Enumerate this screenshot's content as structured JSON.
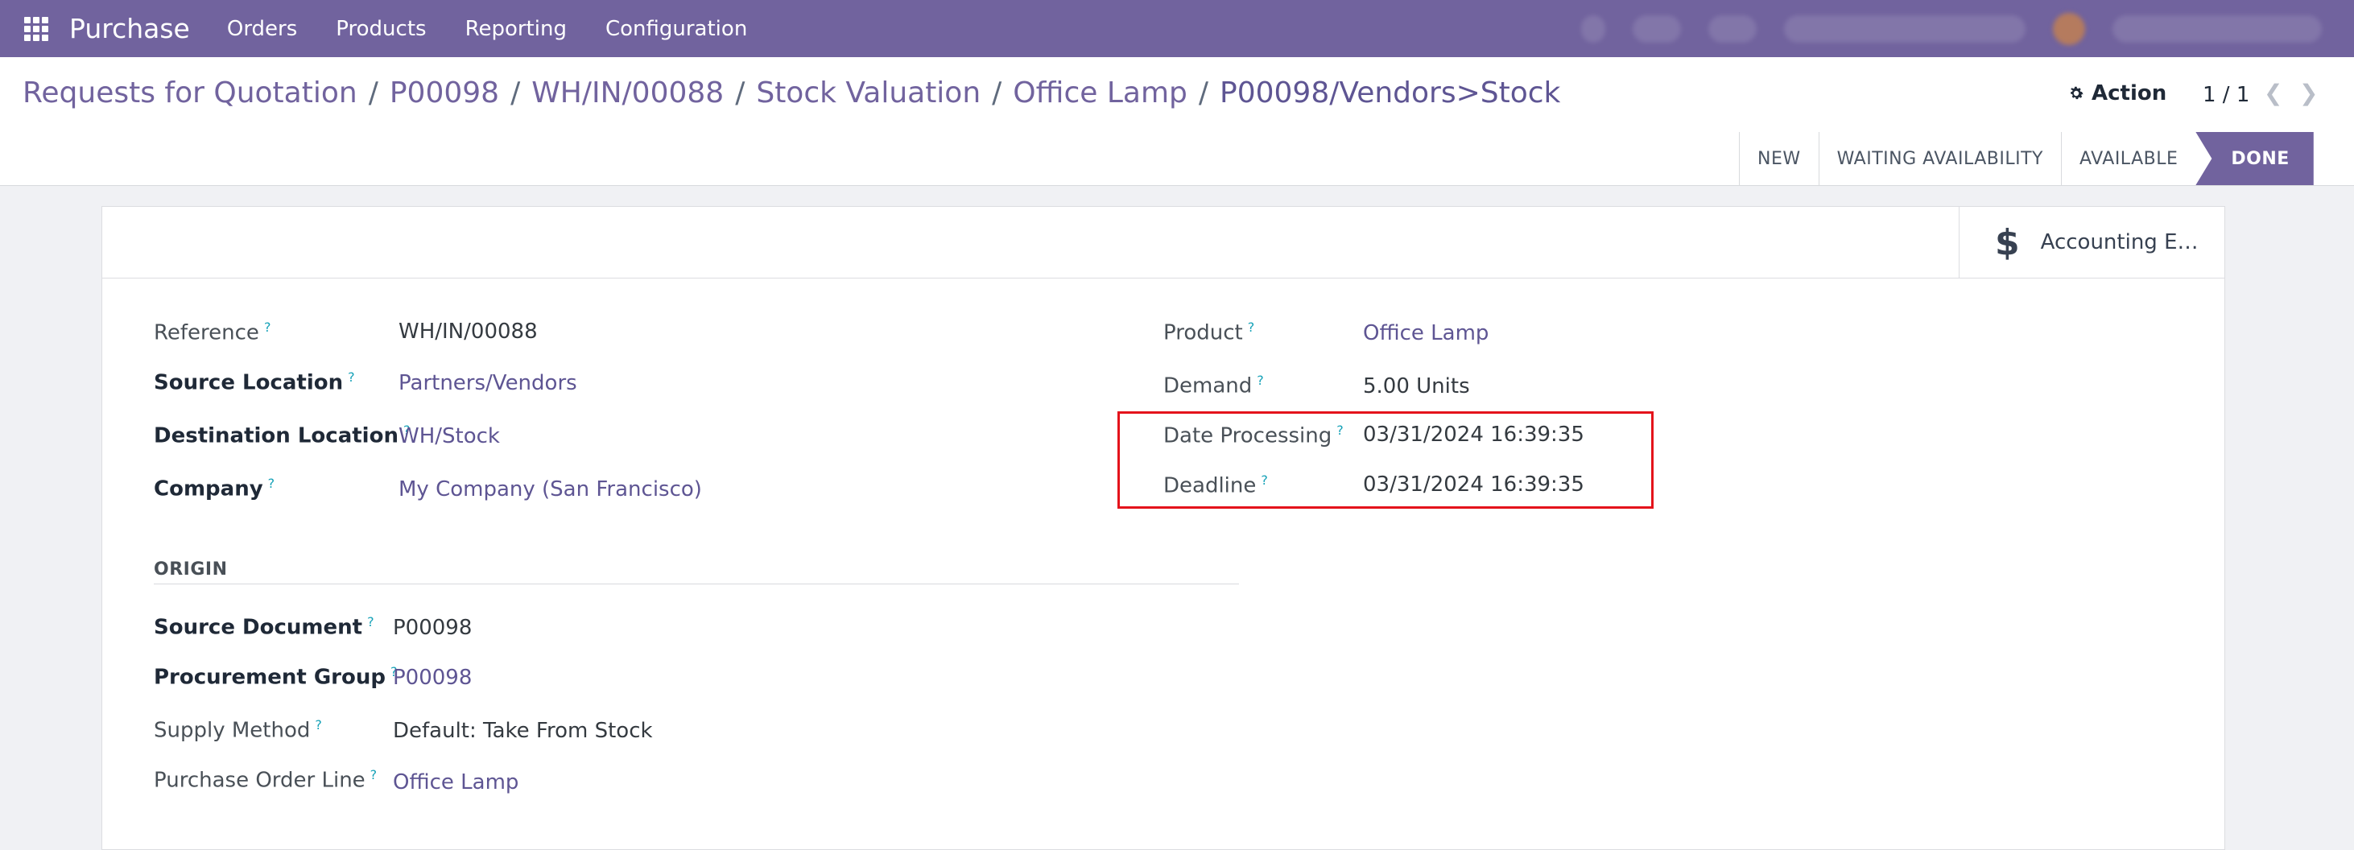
{
  "navbar": {
    "app_name": "Purchase",
    "menu": [
      "Orders",
      "Products",
      "Reporting",
      "Configuration"
    ]
  },
  "breadcrumb": {
    "items": [
      "Requests for Quotation",
      "P00098",
      "WH/IN/00088",
      "Stock Valuation",
      "Office Lamp"
    ],
    "current": "P00098/Vendors>Stock",
    "separator": "/"
  },
  "control": {
    "action_label": "Action",
    "pager": "1 / 1"
  },
  "status": {
    "stages": [
      "NEW",
      "WAITING AVAILABILITY",
      "AVAILABLE",
      "DONE"
    ],
    "active": "DONE"
  },
  "smart_button": {
    "label": "Accounting E…"
  },
  "left_fields": {
    "reference": {
      "label": "Reference",
      "value": "WH/IN/00088"
    },
    "source_location": {
      "label": "Source Location",
      "value": "Partners/Vendors"
    },
    "destination_location": {
      "label": "Destination Location",
      "value": "WH/Stock"
    },
    "company": {
      "label": "Company",
      "value": "My Company (San Francisco)"
    }
  },
  "right_fields": {
    "product": {
      "label": "Product",
      "value": "Office Lamp"
    },
    "demand": {
      "label": "Demand",
      "value": "5.00",
      "unit": "Units"
    },
    "date_processing": {
      "label": "Date Processing",
      "value": "03/31/2024 16:39:35"
    },
    "deadline": {
      "label": "Deadline",
      "value": "03/31/2024 16:39:35"
    }
  },
  "origin": {
    "title": "ORIGIN",
    "source_document": {
      "label": "Source Document",
      "value": "P00098"
    },
    "procurement_group": {
      "label": "Procurement Group",
      "value": "P00098"
    },
    "supply_method": {
      "label": "Supply Method",
      "value": "Default: Take From Stock"
    },
    "purchase_order_line": {
      "label": "Purchase Order Line",
      "value": "Office Lamp"
    }
  },
  "tooltip_marker": "?",
  "colors": {
    "brand": "#71639e",
    "link": "#5e5593",
    "highlight": "#e4131b",
    "tooltip": "#17a2b8"
  }
}
